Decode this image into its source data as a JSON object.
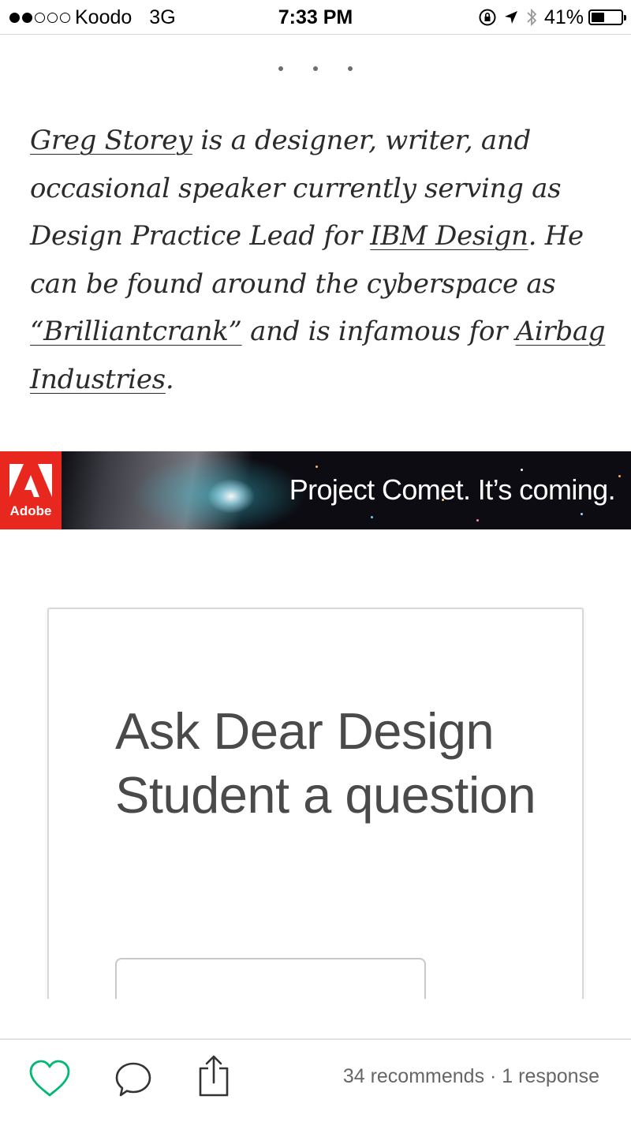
{
  "status_bar": {
    "carrier": "Koodo",
    "network": "3G",
    "time": "7:33 PM",
    "battery": "41%",
    "icons": [
      "orientation-lock-icon",
      "location-arrow-icon",
      "bluetooth-icon",
      "battery-icon"
    ]
  },
  "article": {
    "bio": {
      "author_link": "Greg Storey",
      "text_1": " is a designer, writer, and occasional speaker currently serving as Design Practice Lead for ",
      "ibm_link": "IBM Design",
      "text_2": ". He can be found around the cyberspace as ",
      "alias_link": "“Brilliantcrank”",
      "text_3": " and is infamous for ",
      "airbag_link": "Airbag Industries",
      "text_4": "."
    }
  },
  "ad_banner": {
    "brand": "Adobe",
    "headline": "Project Comet. It’s coming.",
    "colors": {
      "logo_red": "#e8271f",
      "background": "#0c0c12"
    }
  },
  "card": {
    "title": "Ask Dear Design Student a question"
  },
  "action_bar": {
    "recommends": "34 recommends",
    "separator": " · ",
    "responses": "1 response",
    "colors": {
      "accent": "#02b875"
    },
    "icons": [
      "heart-icon",
      "comment-icon",
      "share-icon"
    ]
  }
}
